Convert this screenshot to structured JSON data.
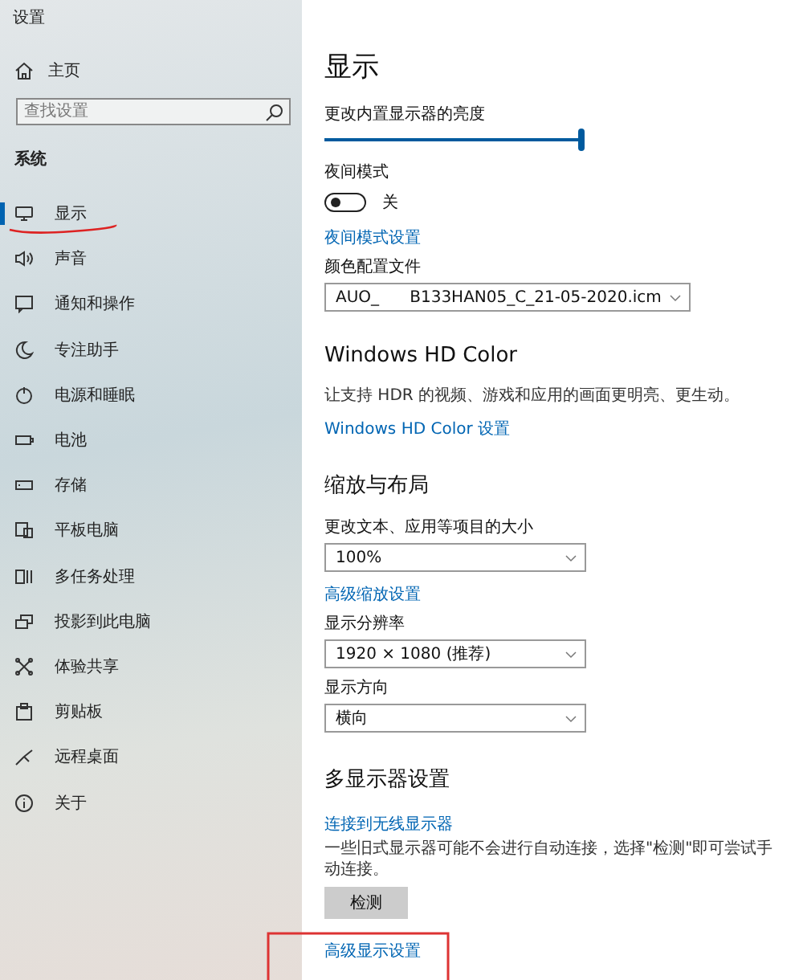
{
  "window": {
    "title": "设置"
  },
  "sidebar": {
    "home": "主页",
    "search": {
      "placeholder": "查找设置"
    },
    "section": "系统",
    "items": [
      {
        "label": "显示",
        "selected": true
      },
      {
        "label": "声音",
        "selected": false
      },
      {
        "label": "通知和操作",
        "selected": false
      },
      {
        "label": "专注助手",
        "selected": false
      },
      {
        "label": "电源和睡眠",
        "selected": false
      },
      {
        "label": "电池",
        "selected": false
      },
      {
        "label": "存储",
        "selected": false
      },
      {
        "label": "平板电脑",
        "selected": false
      },
      {
        "label": "多任务处理",
        "selected": false
      },
      {
        "label": "投影到此电脑",
        "selected": false
      },
      {
        "label": "体验共享",
        "selected": false
      },
      {
        "label": "剪贴板",
        "selected": false
      },
      {
        "label": "远程桌面",
        "selected": false
      },
      {
        "label": "关于",
        "selected": false
      }
    ]
  },
  "page": {
    "title": "显示",
    "rows": [
      {
        "kind": "label",
        "text": "更改内置显示器的亮度"
      },
      {
        "kind": "slider",
        "level": 1
      },
      {
        "kind": "label",
        "text": "夜间模式"
      },
      {
        "kind": "toggle",
        "on": false,
        "text": "关"
      },
      {
        "kind": "link",
        "text": "夜间模式设置"
      },
      {
        "kind": "label",
        "text": "颜色配置文件"
      },
      {
        "kind": "dropdown",
        "value": "AUO_      B133HAN05_C_21-05-2020.icm"
      },
      {
        "kind": "heading",
        "text": "Windows HD Color"
      },
      {
        "kind": "text",
        "text": "让支持 HDR 的视频、游戏和应用的画面更明亮、更生动。"
      },
      {
        "kind": "link",
        "text": "Windows HD Color 设置"
      },
      {
        "kind": "heading",
        "text": "缩放与布局"
      },
      {
        "kind": "label",
        "text": "更改文本、应用等项目的大小"
      },
      {
        "kind": "dropdown",
        "value": "100%"
      },
      {
        "kind": "link",
        "text": "高级缩放设置"
      },
      {
        "kind": "label",
        "text": "显示分辨率"
      },
      {
        "kind": "dropdown",
        "value": "1920 × 1080 (推荐)"
      },
      {
        "kind": "label",
        "text": "显示方向"
      },
      {
        "kind": "dropdown",
        "value": "横向"
      },
      {
        "kind": "heading",
        "text": "多显示器设置"
      },
      {
        "kind": "link",
        "text": "连接到无线显示器"
      },
      {
        "kind": "text",
        "text": "一些旧式显示器可能不会进行自动连接，选择\"检测\"即可尝试手动连接。"
      },
      {
        "kind": "button",
        "text": "检测"
      },
      {
        "kind": "link",
        "text": "高级显示设置"
      }
    ]
  }
}
